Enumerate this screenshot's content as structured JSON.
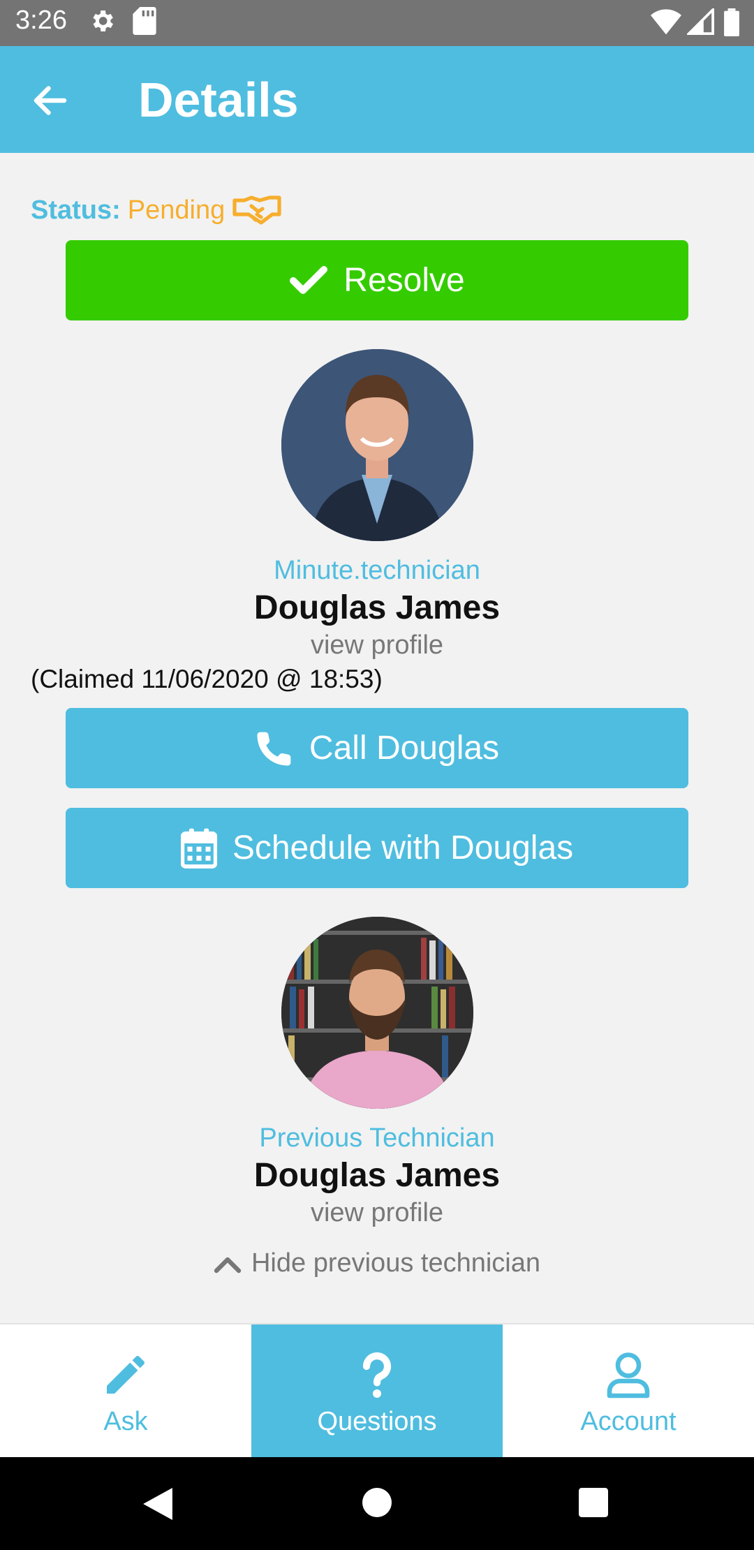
{
  "status_bar": {
    "time": "3:26"
  },
  "app_bar": {
    "title": "Details"
  },
  "status": {
    "label": "Status:",
    "value": "Pending"
  },
  "resolve_button": {
    "label": "Resolve"
  },
  "current_technician": {
    "role": "Minute.technician",
    "name": "Douglas James",
    "view_profile": "view profile",
    "claimed": "(Claimed 11/06/2020 @ 18:53)"
  },
  "call_button": {
    "label": "Call Douglas"
  },
  "schedule_button": {
    "label": "Schedule with Douglas"
  },
  "previous_technician": {
    "role": "Previous Technician",
    "name": "Douglas James",
    "view_profile": "view profile",
    "hide_label": "Hide previous technician"
  },
  "bottom_nav": {
    "items": [
      {
        "label": "Ask",
        "icon": "pencil-icon"
      },
      {
        "label": "Questions",
        "icon": "question-icon",
        "active": true
      },
      {
        "label": "Account",
        "icon": "user-icon"
      }
    ]
  },
  "colors": {
    "accent": "#4fbddf",
    "success": "#34cc00",
    "pending": "#f6ae2d"
  }
}
